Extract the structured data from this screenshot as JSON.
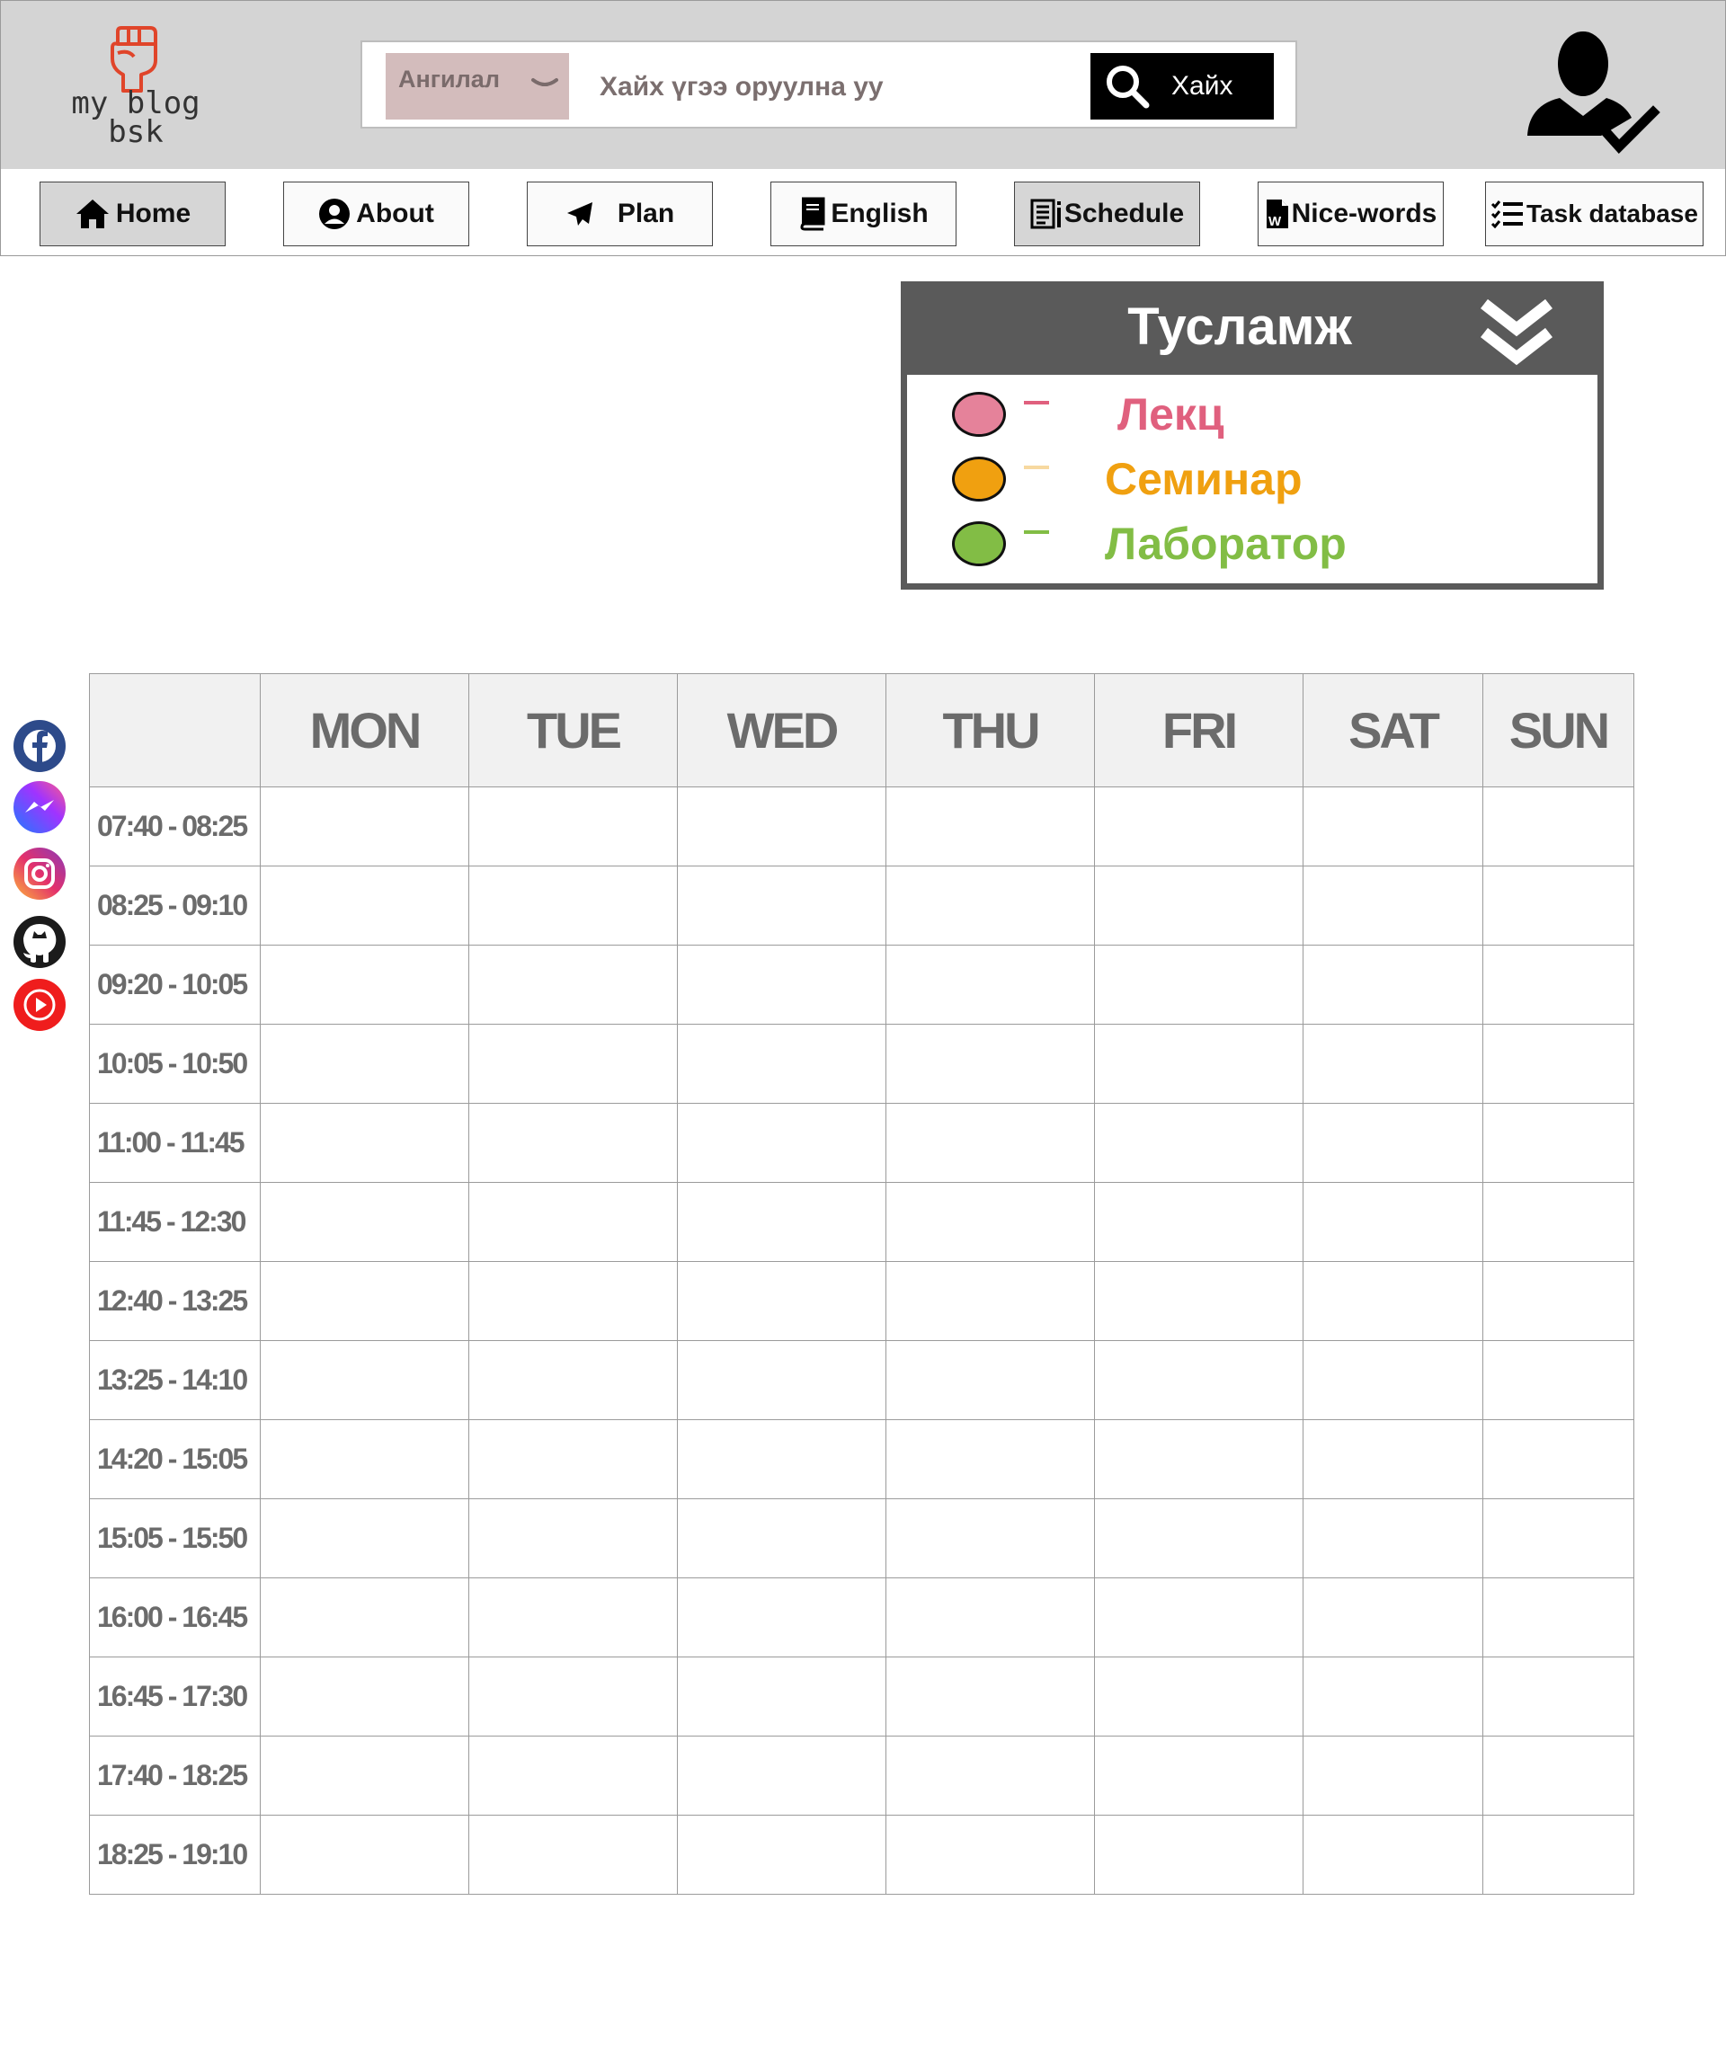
{
  "header": {
    "logo_text_line1": "my blog",
    "logo_text_line2": "bsk",
    "search": {
      "category_label": "Ангилал",
      "placeholder": "Хайх үгээ оруулна уу",
      "button_label": "Хайх"
    }
  },
  "nav": {
    "items": [
      {
        "label": "Home",
        "icon": "home-icon",
        "active": true
      },
      {
        "label": "About",
        "icon": "user-circle-icon",
        "active": false
      },
      {
        "label": "Plan",
        "icon": "paper-plane-icon",
        "active": false
      },
      {
        "label": "English",
        "icon": "book-icon",
        "active": false
      },
      {
        "label": "Schedule",
        "icon": "schedule-list-icon",
        "active": true
      },
      {
        "label": "Nice-words",
        "icon": "word-document-icon",
        "active": false
      },
      {
        "label": "Task database",
        "icon": "task-list-icon",
        "active": false
      }
    ]
  },
  "help": {
    "title": "Тусламж",
    "legend": [
      {
        "label": "Лекц",
        "color": "#e5829a",
        "text_color": "#e0607e",
        "dash_color": "#e0607e"
      },
      {
        "label": "Семинар",
        "color": "#f0a010",
        "text_color": "#f0a010",
        "dash_color": "#f7d9a0"
      },
      {
        "label": "Лаборатор",
        "color": "#82bd45",
        "text_color": "#82bd45",
        "dash_color": "#82bd45"
      }
    ]
  },
  "social": [
    "facebook-icon",
    "messenger-icon",
    "instagram-icon",
    "github-icon",
    "youtube-icon"
  ],
  "schedule": {
    "days": [
      "MON",
      "TUE",
      "WED",
      "THU",
      "FRI",
      "SAT",
      "SUN"
    ],
    "times": [
      "07:40 - 08:25",
      "08:25 - 09:10",
      "09:20 - 10:05",
      "10:05 - 10:50",
      "11:00 - 11:45",
      "11:45 - 12:30",
      "12:40 - 13:25",
      "13:25 - 14:10",
      "14:20 - 15:05",
      "15:05 - 15:50",
      "16:00 - 16:45",
      "16:45 - 17:30",
      "17:40 - 18:25",
      "18:25 - 19:10"
    ]
  },
  "colors": {
    "header_bg": "#d4d4d4",
    "help_bg": "#5a5a5a",
    "category_bg": "#d3bcbc",
    "logo_accent": "#e0452a"
  }
}
